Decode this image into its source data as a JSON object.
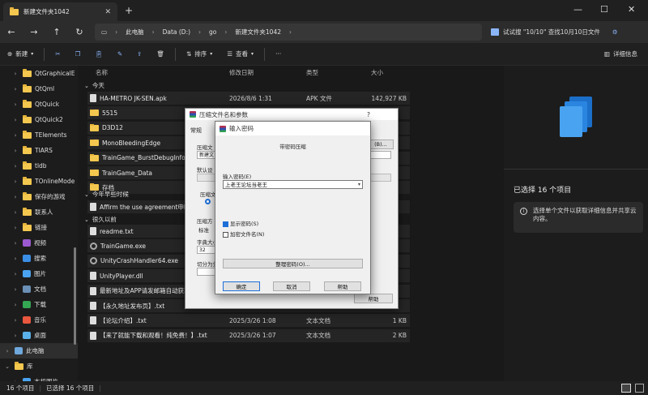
{
  "tab": {
    "title": "新建文件夹1042"
  },
  "breadcrumb": [
    "此电脑",
    "Data (D:)",
    "go",
    "新建文件夹1042"
  ],
  "search": {
    "text": "试试搜 \"10/10\" 查找10月10日文件"
  },
  "commands": {
    "new": "新建",
    "sort": "排序",
    "view": "查看",
    "more": "···",
    "details": "详细信息"
  },
  "nav": [
    {
      "label": "QtGraphicalE",
      "type": "folder"
    },
    {
      "label": "QtQml",
      "type": "folder"
    },
    {
      "label": "QtQuick",
      "type": "folder"
    },
    {
      "label": "QtQuick2",
      "type": "folder"
    },
    {
      "label": "TElements",
      "type": "folder"
    },
    {
      "label": "TIARS",
      "type": "folder"
    },
    {
      "label": "tldb",
      "type": "folder"
    },
    {
      "label": "TOnlineMode",
      "type": "folder"
    },
    {
      "label": "保存的游戏",
      "type": "folder"
    },
    {
      "label": "联系人",
      "type": "folder"
    },
    {
      "label": "链接",
      "type": "folder"
    },
    {
      "label": "视频",
      "type": "video"
    },
    {
      "label": "搜索",
      "type": "search"
    },
    {
      "label": "图片",
      "type": "image"
    },
    {
      "label": "文档",
      "type": "doc"
    },
    {
      "label": "下载",
      "type": "download"
    },
    {
      "label": "音乐",
      "type": "music"
    },
    {
      "label": "桌面",
      "type": "desktop"
    },
    {
      "label": "此电脑",
      "type": "pc"
    },
    {
      "label": "库",
      "type": "folder"
    },
    {
      "label": "本机图片",
      "type": "image"
    }
  ],
  "columns": {
    "name": "名称",
    "date": "修改日期",
    "type": "类型",
    "size": "大小"
  },
  "groups": {
    "today": "今天",
    "earlier": "今年早些时候",
    "long_ago": "很久以前"
  },
  "files_today": [
    {
      "name": "HA-METRO JK-SEN.apk",
      "date": "2026/8/6 1:31",
      "type": "APK 文件",
      "size": "142,927 KB",
      "icon": "file"
    },
    {
      "name": "5515",
      "date": "",
      "type": "",
      "size": "",
      "icon": "folder"
    },
    {
      "name": "D3D12",
      "date": "",
      "type": "",
      "size": "",
      "icon": "folder"
    },
    {
      "name": "MonoBleedingEdge",
      "date": "",
      "type": "",
      "size": "",
      "icon": "folder"
    },
    {
      "name": "TrainGame_BurstDebugInforma",
      "date": "",
      "type": "",
      "size": "",
      "icon": "folder"
    },
    {
      "name": "TrainGame_Data",
      "date": "",
      "type": "",
      "size": "",
      "icon": "folder"
    },
    {
      "name": "存档",
      "date": "",
      "type": "",
      "size": "",
      "icon": "folder"
    }
  ],
  "files_earlier": [
    {
      "name": "Affirm the use agreement申明使",
      "date": "",
      "type": "",
      "size": "",
      "icon": "file"
    }
  ],
  "files_long_ago": [
    {
      "name": "readme.txt",
      "date": "",
      "type": "",
      "size": "",
      "icon": "file"
    },
    {
      "name": "TrainGame.exe",
      "date": "",
      "type": "",
      "size": "",
      "icon": "gear"
    },
    {
      "name": "UnityCrashHandler64.exe",
      "date": "",
      "type": "",
      "size": "",
      "icon": "gear"
    },
    {
      "name": "UnityPlayer.dll",
      "date": "",
      "type": "",
      "size": "",
      "icon": "file"
    },
    {
      "name": "最新地址及APP请发邮箱自动获取",
      "date": "",
      "type": "",
      "size": "",
      "icon": "file"
    },
    {
      "name": "【永久地址发布页】.txt",
      "date": "",
      "type": "",
      "size": "",
      "icon": "file"
    },
    {
      "name": "【论坛介绍】.txt",
      "date": "2025/3/26 1:08",
      "type": "文本文档",
      "size": "1 KB",
      "icon": "file"
    },
    {
      "name": "【来了就能下载和观看！纯免费！】.txt",
      "date": "2025/3/26 1:07",
      "type": "文本文档",
      "size": "2 KB",
      "icon": "file"
    }
  ],
  "details_pane": {
    "selected": "已选择 16 个项目",
    "hint": "选择单个文件以获取详细信息并共享云内容。"
  },
  "status": {
    "count": "16 个项目",
    "selected": "已选择 16 个项目"
  },
  "dialog_archive": {
    "title": "压缩文件名和参数",
    "help_btn": "?",
    "tab_general": "常规",
    "label_archive_name": "压缩文",
    "archive_name_value": "新建文",
    "browse_fragment": "(B)...",
    "label_default": "默认设",
    "label_format": "压缩文",
    "label_method": "压缩方",
    "method_value": "标准",
    "label_dict": "字典大小",
    "dict_value": "32",
    "label_split": "切分为分",
    "help_button": "帮助"
  },
  "dialog_password": {
    "title": "输入密码",
    "subtitle": "带密码压缩",
    "label_password": "输入密码(E)",
    "password_value": "上老王论坛当老王",
    "show_password": "显示密码(S)",
    "encrypt_names": "加密文件名(N)",
    "organize_button": "整理密码(O)...",
    "ok_button": "确定",
    "cancel_button": "取消",
    "help_button": "帮助"
  }
}
